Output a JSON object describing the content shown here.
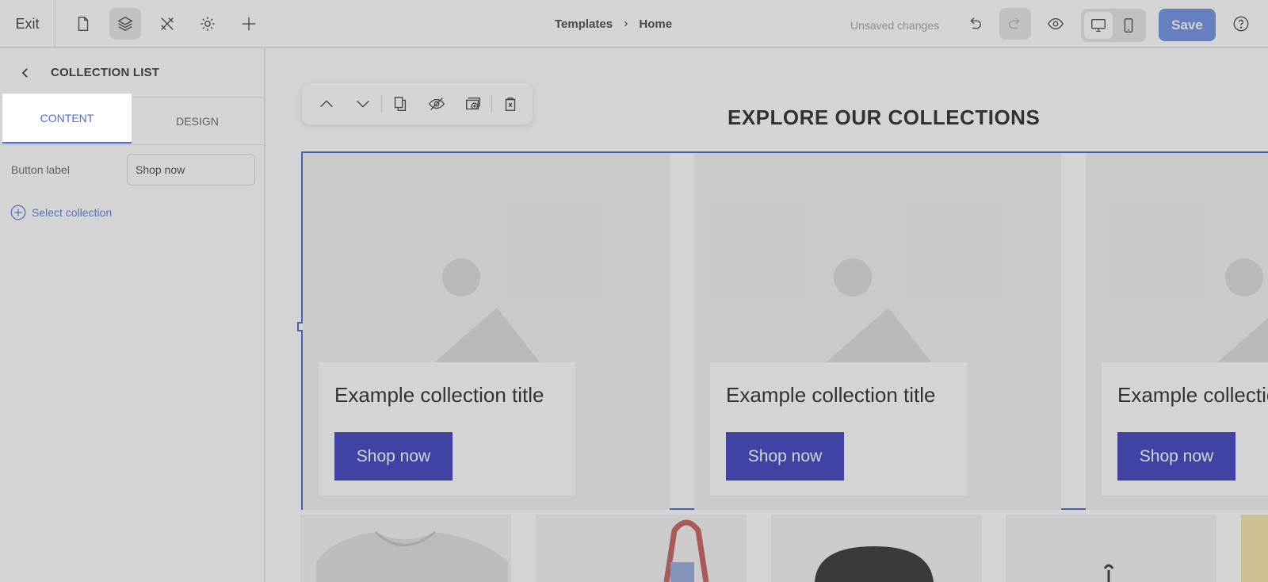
{
  "topbar": {
    "exit_label": "Exit",
    "breadcrumb": [
      "Templates",
      "Home"
    ],
    "unsaved_label": "Unsaved changes",
    "save_label": "Save"
  },
  "sidebar": {
    "title": "COLLECTION LIST",
    "tabs": [
      {
        "label": "CONTENT",
        "active": true
      },
      {
        "label": "DESIGN",
        "active": false
      }
    ],
    "fields": {
      "button_label": {
        "label": "Button label",
        "value": "Shop now"
      }
    },
    "select_collection_label": "Select collection"
  },
  "canvas": {
    "section_title": "EXPLORE OUR COLLECTIONS",
    "cards": [
      {
        "title": "Example collection title",
        "button": "Shop now"
      },
      {
        "title": "Example collection title",
        "button": "Shop now"
      },
      {
        "title": "Example collection title",
        "button": "Shop now"
      }
    ]
  },
  "colors": {
    "accent": "#4a6cd4",
    "save_button": "#5c84e0",
    "card_button": "#2629b8",
    "selection_border": "#2c55c8"
  },
  "icons": {
    "toolbar": [
      "page-icon",
      "layers-icon",
      "tools-icon",
      "gear-icon",
      "plus-icon"
    ],
    "right": [
      "undo-icon",
      "redo-icon",
      "eye-icon",
      "desktop-icon",
      "mobile-icon",
      "help-icon"
    ],
    "floating_toolbar": [
      "move-up-icon",
      "move-down-icon",
      "duplicate-icon",
      "hide-icon",
      "add-section-icon",
      "delete-icon"
    ]
  }
}
